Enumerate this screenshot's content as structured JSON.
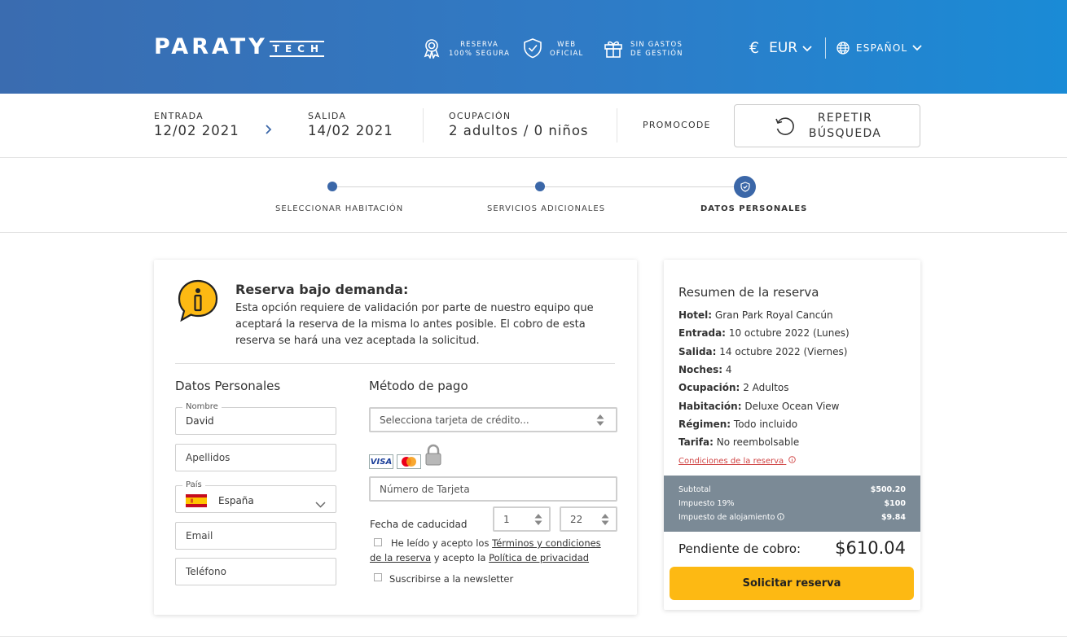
{
  "header": {
    "logo_main": "PARATY",
    "logo_sub": "TECH",
    "trust": [
      {
        "line1": "RESERVA",
        "line2": "100% SEGURA",
        "icon": "award-icon"
      },
      {
        "line1": "WEB",
        "line2": "OFICIAL",
        "icon": "shield-check-icon"
      },
      {
        "line1": "SIN GASTOS",
        "line2": "DE GESTIÓN",
        "icon": "gift-icon"
      }
    ],
    "currency_symbol": "€",
    "currency": "EUR",
    "language": "ESPAÑOL"
  },
  "search": {
    "entrada_label": "ENTRADA",
    "entrada_value": "12/02 2021",
    "salida_label": "SALIDA",
    "salida_value": "14/02 2021",
    "ocupacion_label": "OCUPACIÓN",
    "ocupacion_value": "2 adultos / 0 niños",
    "promocode_label": "PROMOCODE",
    "repeat_line1": "REPETIR",
    "repeat_line2": "BÚSQUEDA"
  },
  "steps": [
    {
      "label": "SELECCIONAR HABITACIÓN",
      "state": "done"
    },
    {
      "label": "SERVICIOS ADICIONALES",
      "state": "done"
    },
    {
      "label": "DATOS PERSONALES",
      "state": "active"
    }
  ],
  "notice": {
    "title": "Reserva bajo demanda:",
    "body": "Esta opción requiere de validación por parte de nuestro equipo que aceptará la reserva de la misma lo antes posible. El cobro de esta reserva se hará una vez aceptada la solicitud."
  },
  "personal": {
    "title": "Datos Personales",
    "nombre_label": "Nombre",
    "nombre_value": "David",
    "apellidos_placeholder": "Apellidos",
    "pais_label": "País",
    "pais_value": "España",
    "email_placeholder": "Email",
    "telefono_placeholder": "Teléfono"
  },
  "payment": {
    "title": "Método de pago",
    "card_select_placeholder": "Selecciona tarjeta de crédito...",
    "card_brands": [
      "VISA",
      "Mastercard"
    ],
    "card_number_placeholder": "Número de Tarjeta",
    "expiry_label": "Fecha de caducidad",
    "expiry_month": "1",
    "expiry_year": "22",
    "terms_prefix": "He leído y acepto los",
    "terms_link": "Términos y condiciones de la reserva",
    "terms_middle": "y acepto la",
    "privacy_link": "Política de privacidad",
    "newsletter": "Suscribirse a la newsletter"
  },
  "summary": {
    "title": "Resumen de la reserva",
    "rows": [
      {
        "label": "Hotel:",
        "value": "Gran Park Royal Cancún"
      },
      {
        "label": "Entrada:",
        "value": "10 octubre 2022 (Lunes)"
      },
      {
        "label": "Salida:",
        "value": "14 octubre 2022 (Viernes)"
      },
      {
        "label": "Noches:",
        "value": "4"
      },
      {
        "label": "Ocupación:",
        "value": "2 Adultos"
      },
      {
        "label": "Habitación:",
        "value": "Deluxe Ocean View"
      },
      {
        "label": "Régimen:",
        "value": "Todo incluido"
      },
      {
        "label": "Tarifa:",
        "value": "No reembolsable"
      }
    ],
    "conditions_link": "Condiciones de la reserva",
    "totals": [
      {
        "label": "Subtotal",
        "value": "$500.20"
      },
      {
        "label": "Impuesto 19%",
        "value": "$100"
      },
      {
        "label": "Impuesto de alojamiento",
        "value": "$9.84"
      }
    ],
    "pending_label": "Pendiente de cobro:",
    "pending_value": "$610.04",
    "request_button": "Solicitar reserva"
  },
  "colors": {
    "header_gradient_start": "#3a6cb0",
    "header_gradient_end": "#1a8bd6",
    "accent": "#3b67a8",
    "cta": "#fdb913",
    "totals_band": "#7b8a96",
    "link_red": "#d04545"
  }
}
